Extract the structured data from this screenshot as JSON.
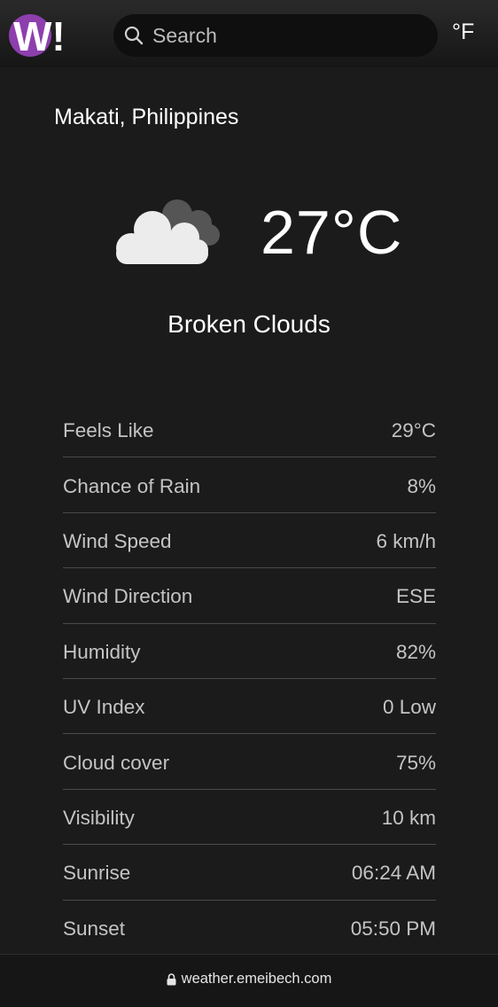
{
  "header": {
    "logo_text": "W!",
    "brand_color": "#8e3fae",
    "search": {
      "placeholder": "Search",
      "value": ""
    },
    "unit_toggle": "°F"
  },
  "location": "Makati, Philippines",
  "current": {
    "icon": "broken-clouds-icon",
    "temperature": "27°C",
    "condition": "Broken Clouds"
  },
  "details": [
    {
      "label": "Feels Like",
      "value": "29°C"
    },
    {
      "label": "Chance of Rain",
      "value": "8%"
    },
    {
      "label": "Wind Speed",
      "value": "6 km/h"
    },
    {
      "label": "Wind Direction",
      "value": "ESE"
    },
    {
      "label": "Humidity",
      "value": "82%"
    },
    {
      "label": "UV Index",
      "value": "0 Low"
    },
    {
      "label": "Cloud cover",
      "value": "75%"
    },
    {
      "label": "Visibility",
      "value": "10 km"
    },
    {
      "label": "Sunrise",
      "value": "06:24 AM"
    },
    {
      "label": "Sunset",
      "value": "05:50 PM"
    }
  ],
  "footer": {
    "icon": "lock-icon",
    "url": "weather.emeibech.com"
  }
}
